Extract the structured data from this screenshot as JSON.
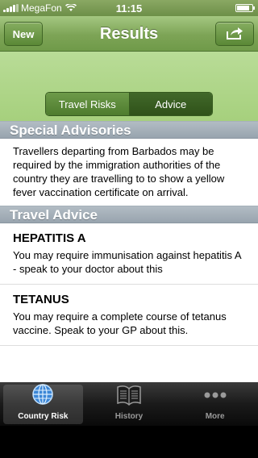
{
  "status": {
    "carrier": "MegaFon",
    "time": "11:15"
  },
  "navbar": {
    "left_button": "New",
    "title": "Results",
    "right_icon": "share-icon"
  },
  "segments": [
    {
      "label": "Travel Risks",
      "selected": false
    },
    {
      "label": "Advice",
      "selected": true
    }
  ],
  "special_advisories": {
    "header": "Special Advisories",
    "text": "Travellers departing from Barbados may be required by the immigration authorities of the country they are travelling to to show a yellow fever vaccination certificate on arrival."
  },
  "travel_advice": {
    "header": "Travel Advice",
    "items": [
      {
        "title": "HEPATITIS A",
        "text": "You may require immunisation against hepatitis A - speak to your doctor about this"
      },
      {
        "title": "TETANUS",
        "text": "You may require a complete course of tetanus vaccine.  Speak to your GP about this."
      }
    ]
  },
  "tabbar": {
    "tabs": [
      {
        "label": "Country Risk",
        "icon": "globe-icon",
        "active": true
      },
      {
        "label": "History",
        "icon": "book-icon",
        "active": false
      },
      {
        "label": "More",
        "icon": "more-icon",
        "active": false
      }
    ]
  },
  "colors": {
    "nav_green": "#7da456",
    "segment_bg": "#a6d07d",
    "section_header": "#98a4ae"
  }
}
